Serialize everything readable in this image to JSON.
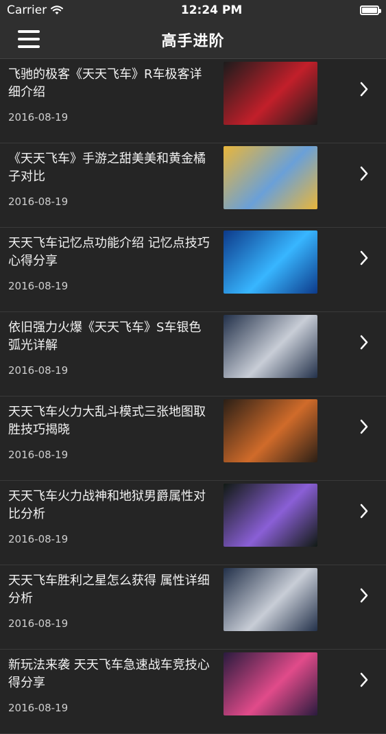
{
  "status_bar": {
    "carrier": "Carrier",
    "time": "12:24 PM"
  },
  "navbar": {
    "title": "高手进阶"
  },
  "articles": [
    {
      "title": "飞驰的极客《天天飞车》R车极客详细介绍",
      "date": "2016-08-19",
      "thumb_colors": [
        "#1c1c1c",
        "#c21f2a"
      ]
    },
    {
      "title": "《天天飞车》手游之甜美美和黄金橘子对比",
      "date": "2016-08-19",
      "thumb_colors": [
        "#e9b63a",
        "#6aa0d8"
      ]
    },
    {
      "title": "天天飞车记忆点功能介绍 记忆点技巧心得分享",
      "date": "2016-08-19",
      "thumb_colors": [
        "#0d3a8a",
        "#38b6ff"
      ]
    },
    {
      "title": "依旧强力火爆《天天飞车》S车银色弧光详解",
      "date": "2016-08-19",
      "thumb_colors": [
        "#23314a",
        "#c8cdd6"
      ]
    },
    {
      "title": "天天飞车火力大乱斗模式三张地图取胜技巧揭晓",
      "date": "2016-08-19",
      "thumb_colors": [
        "#2b1f16",
        "#d06b2a"
      ]
    },
    {
      "title": "天天飞车火力战神和地狱男爵属性对比分析",
      "date": "2016-08-19",
      "thumb_colors": [
        "#111a14",
        "#8a5fd6"
      ]
    },
    {
      "title": "天天飞车胜利之星怎么获得 属性详细分析",
      "date": "2016-08-19",
      "thumb_colors": [
        "#23314a",
        "#c8cdd6"
      ]
    },
    {
      "title": "新玩法来袭 天天飞车急速战车竞技心得分享",
      "date": "2016-08-19",
      "thumb_colors": [
        "#2a1b3e",
        "#e14b8a"
      ]
    }
  ]
}
